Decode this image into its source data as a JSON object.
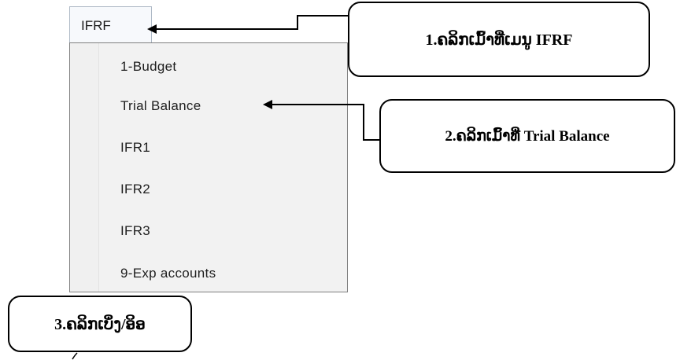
{
  "menu": {
    "tab_label": "IFRF",
    "items": [
      "1-Budget",
      "Trial Balance",
      "IFR1",
      "IFR2",
      "IFR3",
      "9-Exp accounts"
    ]
  },
  "callouts": {
    "step1": "1.ຄລິກເມົ້າທີ່ເມນູ IFRF",
    "step2": "2.ຄລິກເມົ້າທີ່ Trial Balance",
    "step3": "3.ຄລິກເບິ່ງ/ອິອ"
  },
  "colors": {
    "menu_border": "#7f7f7f",
    "menu_background": "#f2f2f2",
    "callout_border": "#000000"
  }
}
